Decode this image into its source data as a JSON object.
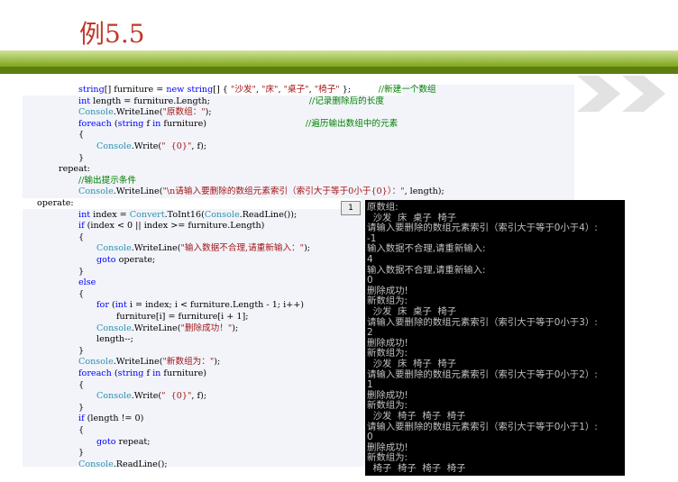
{
  "slide": {
    "title": "例5.5"
  },
  "code": {
    "badge": "1",
    "lines": [
      {
        "indent": 62,
        "hl": true,
        "parts": [
          [
            "kw",
            "string"
          ],
          [
            "t",
            "[] furniture = "
          ],
          [
            "kw",
            "new"
          ],
          [
            "t",
            " "
          ],
          [
            "kw",
            "string"
          ],
          [
            "t",
            "[] { "
          ],
          [
            "str",
            "\"沙发\""
          ],
          [
            "t",
            ", "
          ],
          [
            "str",
            "\"床\""
          ],
          [
            "t",
            ", "
          ],
          [
            "str",
            "\"桌子\""
          ],
          [
            "t",
            ", "
          ],
          [
            "str",
            "\"椅子\""
          ],
          [
            "t",
            " };"
          ],
          [
            "pad",
            "          "
          ],
          [
            "cm",
            "//新建一个数组"
          ]
        ]
      },
      {
        "indent": 62,
        "hl": false,
        "parts": [
          [
            "kw",
            "int"
          ],
          [
            "t",
            " length = furniture.Length;"
          ],
          [
            "pad",
            "                                    "
          ],
          [
            "cm",
            "//记录删除后的长度"
          ]
        ]
      },
      {
        "indent": 62,
        "hl": false,
        "parts": [
          [
            "cls",
            "Console"
          ],
          [
            "t",
            ".WriteLine("
          ],
          [
            "str",
            "\"原数组：\""
          ],
          [
            "t",
            ");"
          ]
        ]
      },
      {
        "indent": 62,
        "hl": false,
        "parts": [
          [
            "kw",
            "foreach"
          ],
          [
            "t",
            " ("
          ],
          [
            "kw",
            "string"
          ],
          [
            "t",
            " f "
          ],
          [
            "kw",
            "in"
          ],
          [
            "t",
            " furniture)"
          ],
          [
            "pad",
            "                                    "
          ],
          [
            "cm",
            "//遍历输出数组中的元素"
          ]
        ]
      },
      {
        "indent": 62,
        "hl": false,
        "parts": [
          [
            "t",
            "{"
          ]
        ]
      },
      {
        "indent": 82,
        "hl": false,
        "parts": [
          [
            "cls",
            "Console"
          ],
          [
            "t",
            ".Write("
          ],
          [
            "str",
            "\"  {0}\""
          ],
          [
            "t",
            ", f);"
          ]
        ]
      },
      {
        "indent": 62,
        "hl": false,
        "parts": [
          [
            "t",
            "}"
          ]
        ]
      },
      {
        "indent": 40,
        "hl": false,
        "parts": [
          [
            "t",
            "repeat:"
          ]
        ]
      },
      {
        "indent": 62,
        "hl": false,
        "parts": [
          [
            "cm",
            "//输出提示条件"
          ]
        ]
      },
      {
        "indent": 62,
        "hl": false,
        "parts": [
          [
            "cls",
            "Console"
          ],
          [
            "t",
            ".WriteLine("
          ],
          [
            "str",
            "\"\\n请输入要删除的数组元素索引（索引大于等于0小于{0}）：\""
          ],
          [
            "t",
            ", length);"
          ]
        ]
      },
      {
        "indent": 16,
        "hl": true,
        "parts": [
          [
            "t",
            "operate:"
          ]
        ]
      },
      {
        "indent": 62,
        "hl": false,
        "parts": [
          [
            "kw",
            "int"
          ],
          [
            "t",
            " index = "
          ],
          [
            "cls",
            "Convert"
          ],
          [
            "t",
            ".ToInt16("
          ],
          [
            "cls",
            "Console"
          ],
          [
            "t",
            ".ReadLine());"
          ]
        ]
      },
      {
        "indent": 62,
        "hl": false,
        "parts": [
          [
            "kw",
            "if"
          ],
          [
            "t",
            " (index < 0 || index >= furniture.Length)"
          ]
        ]
      },
      {
        "indent": 62,
        "hl": false,
        "parts": [
          [
            "t",
            "{"
          ]
        ]
      },
      {
        "indent": 82,
        "hl": false,
        "parts": [
          [
            "cls",
            "Console"
          ],
          [
            "t",
            ".WriteLine("
          ],
          [
            "str",
            "\"输入数据不合理,请重新输入：\""
          ],
          [
            "t",
            ");"
          ]
        ]
      },
      {
        "indent": 82,
        "hl": false,
        "parts": [
          [
            "kw",
            "goto"
          ],
          [
            "t",
            " operate;"
          ]
        ]
      },
      {
        "indent": 62,
        "hl": false,
        "parts": [
          [
            "t",
            "}"
          ]
        ]
      },
      {
        "indent": 62,
        "hl": false,
        "parts": [
          [
            "kw",
            "else"
          ]
        ]
      },
      {
        "indent": 62,
        "hl": false,
        "parts": [
          [
            "t",
            "{"
          ]
        ]
      },
      {
        "indent": 82,
        "hl": false,
        "parts": [
          [
            "kw",
            "for"
          ],
          [
            "t",
            " ("
          ],
          [
            "kw",
            "int"
          ],
          [
            "t",
            " i = index; i < furniture.Length - 1; i++)"
          ]
        ]
      },
      {
        "indent": 104,
        "hl": false,
        "parts": [
          [
            "t",
            "furniture[i] = furniture[i + 1];"
          ]
        ]
      },
      {
        "indent": 82,
        "hl": false,
        "parts": [
          [
            "cls",
            "Console"
          ],
          [
            "t",
            ".WriteLine("
          ],
          [
            "str",
            "\"删除成功！\""
          ],
          [
            "t",
            ");"
          ]
        ]
      },
      {
        "indent": 82,
        "hl": false,
        "parts": [
          [
            "t",
            "length--;"
          ]
        ]
      },
      {
        "indent": 62,
        "hl": false,
        "parts": [
          [
            "t",
            "}"
          ]
        ]
      },
      {
        "indent": 62,
        "hl": false,
        "parts": [
          [
            "cls",
            "Console"
          ],
          [
            "t",
            ".WriteLine("
          ],
          [
            "str",
            "\"新数组为：\""
          ],
          [
            "t",
            ");"
          ]
        ]
      },
      {
        "indent": 62,
        "hl": false,
        "parts": [
          [
            "kw",
            "foreach"
          ],
          [
            "t",
            " ("
          ],
          [
            "kw",
            "string"
          ],
          [
            "t",
            " f "
          ],
          [
            "kw",
            "in"
          ],
          [
            "t",
            " furniture)"
          ]
        ]
      },
      {
        "indent": 62,
        "hl": false,
        "parts": [
          [
            "t",
            "{"
          ]
        ]
      },
      {
        "indent": 82,
        "hl": false,
        "parts": [
          [
            "cls",
            "Console"
          ],
          [
            "t",
            ".Write("
          ],
          [
            "str",
            "\"  {0}\""
          ],
          [
            "t",
            ", f);"
          ]
        ]
      },
      {
        "indent": 62,
        "hl": false,
        "parts": [
          [
            "t",
            "}"
          ]
        ]
      },
      {
        "indent": 62,
        "hl": false,
        "parts": [
          [
            "kw",
            "if"
          ],
          [
            "t",
            " (length != 0)"
          ]
        ]
      },
      {
        "indent": 62,
        "hl": false,
        "parts": [
          [
            "t",
            "{"
          ]
        ]
      },
      {
        "indent": 82,
        "hl": false,
        "parts": [
          [
            "kw",
            "goto"
          ],
          [
            "t",
            " repeat;"
          ]
        ]
      },
      {
        "indent": 62,
        "hl": false,
        "parts": [
          [
            "t",
            "}"
          ]
        ]
      },
      {
        "indent": 62,
        "hl": false,
        "parts": [
          [
            "cls",
            "Console"
          ],
          [
            "t",
            ".ReadLine();"
          ]
        ]
      }
    ]
  },
  "console": {
    "lines": [
      "原数组:",
      "  沙发  床  桌子  椅子",
      "请输入要删除的数组元素索引（索引大于等于0小于4）:",
      "-1",
      "输入数据不合理,请重新输入:",
      "4",
      "输入数据不合理,请重新输入:",
      "0",
      "删除成功!",
      "新数组为:",
      "  沙发  床  桌子  椅子",
      "请输入要删除的数组元素索引（索引大于等于0小于3）:",
      "2",
      "删除成功!",
      "新数组为:",
      "  沙发  床  椅子  椅子",
      "请输入要删除的数组元素索引（索引大于等于0小于2）:",
      "1",
      "删除成功!",
      "新数组为:",
      "  沙发  椅子  椅子  椅子",
      "请输入要删除的数组元素索引（索引大于等于0小于1）:",
      "0",
      "删除成功!",
      "新数组为:",
      "  椅子  椅子  椅子  椅子"
    ]
  }
}
